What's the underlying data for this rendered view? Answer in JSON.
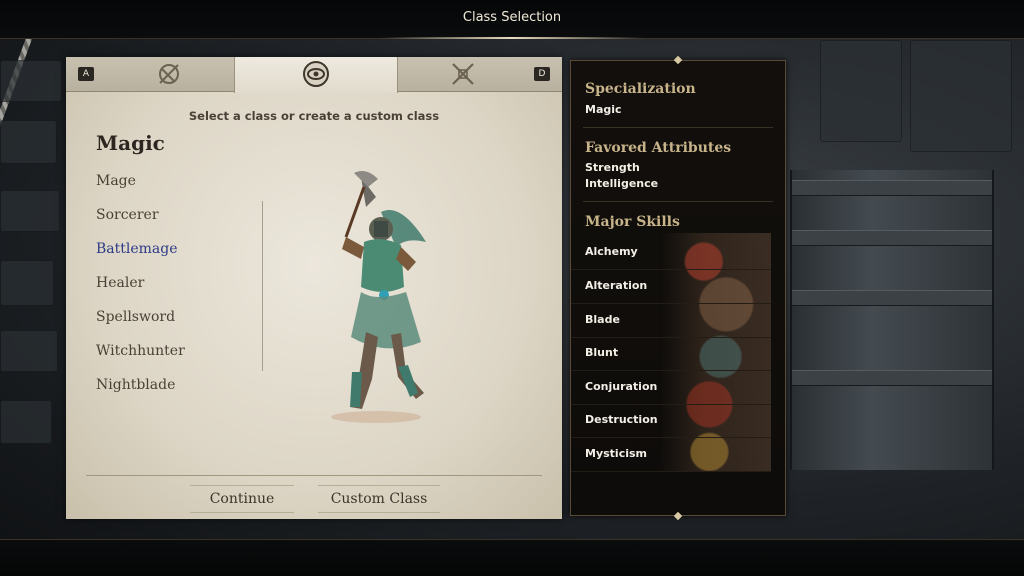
{
  "header": {
    "title": "Class Selection"
  },
  "tabs": {
    "left_key": "A",
    "right_key": "D",
    "items": [
      {
        "icon": "compass-rune-icon"
      },
      {
        "icon": "eye-emblem-icon"
      },
      {
        "icon": "crossed-swords-icon"
      }
    ]
  },
  "class_panel": {
    "subtitle": "Select a class or create a custom class",
    "group_title": "Magic",
    "classes": [
      {
        "label": "Mage"
      },
      {
        "label": "Sorcerer"
      },
      {
        "label": "Battlemage",
        "selected": true
      },
      {
        "label": "Healer"
      },
      {
        "label": "Spellsword"
      },
      {
        "label": "Witchhunter"
      },
      {
        "label": "Nightblade"
      }
    ],
    "continue_label": "Continue",
    "custom_label": "Custom Class"
  },
  "details": {
    "specialization_title": "Specialization",
    "specialization_value": "Magic",
    "attributes_title": "Favored Attributes",
    "attributes": [
      "Strength",
      "Intelligence"
    ],
    "skills_title": "Major Skills",
    "skills": [
      "Alchemy",
      "Alteration",
      "Blade",
      "Blunt",
      "Conjuration",
      "Destruction",
      "Mysticism"
    ]
  },
  "colors": {
    "parchment": "#e6e0d3",
    "selected_text": "#2c3a86",
    "panel_bg": "#120f0c",
    "gold_heading": "#c8b48a"
  }
}
